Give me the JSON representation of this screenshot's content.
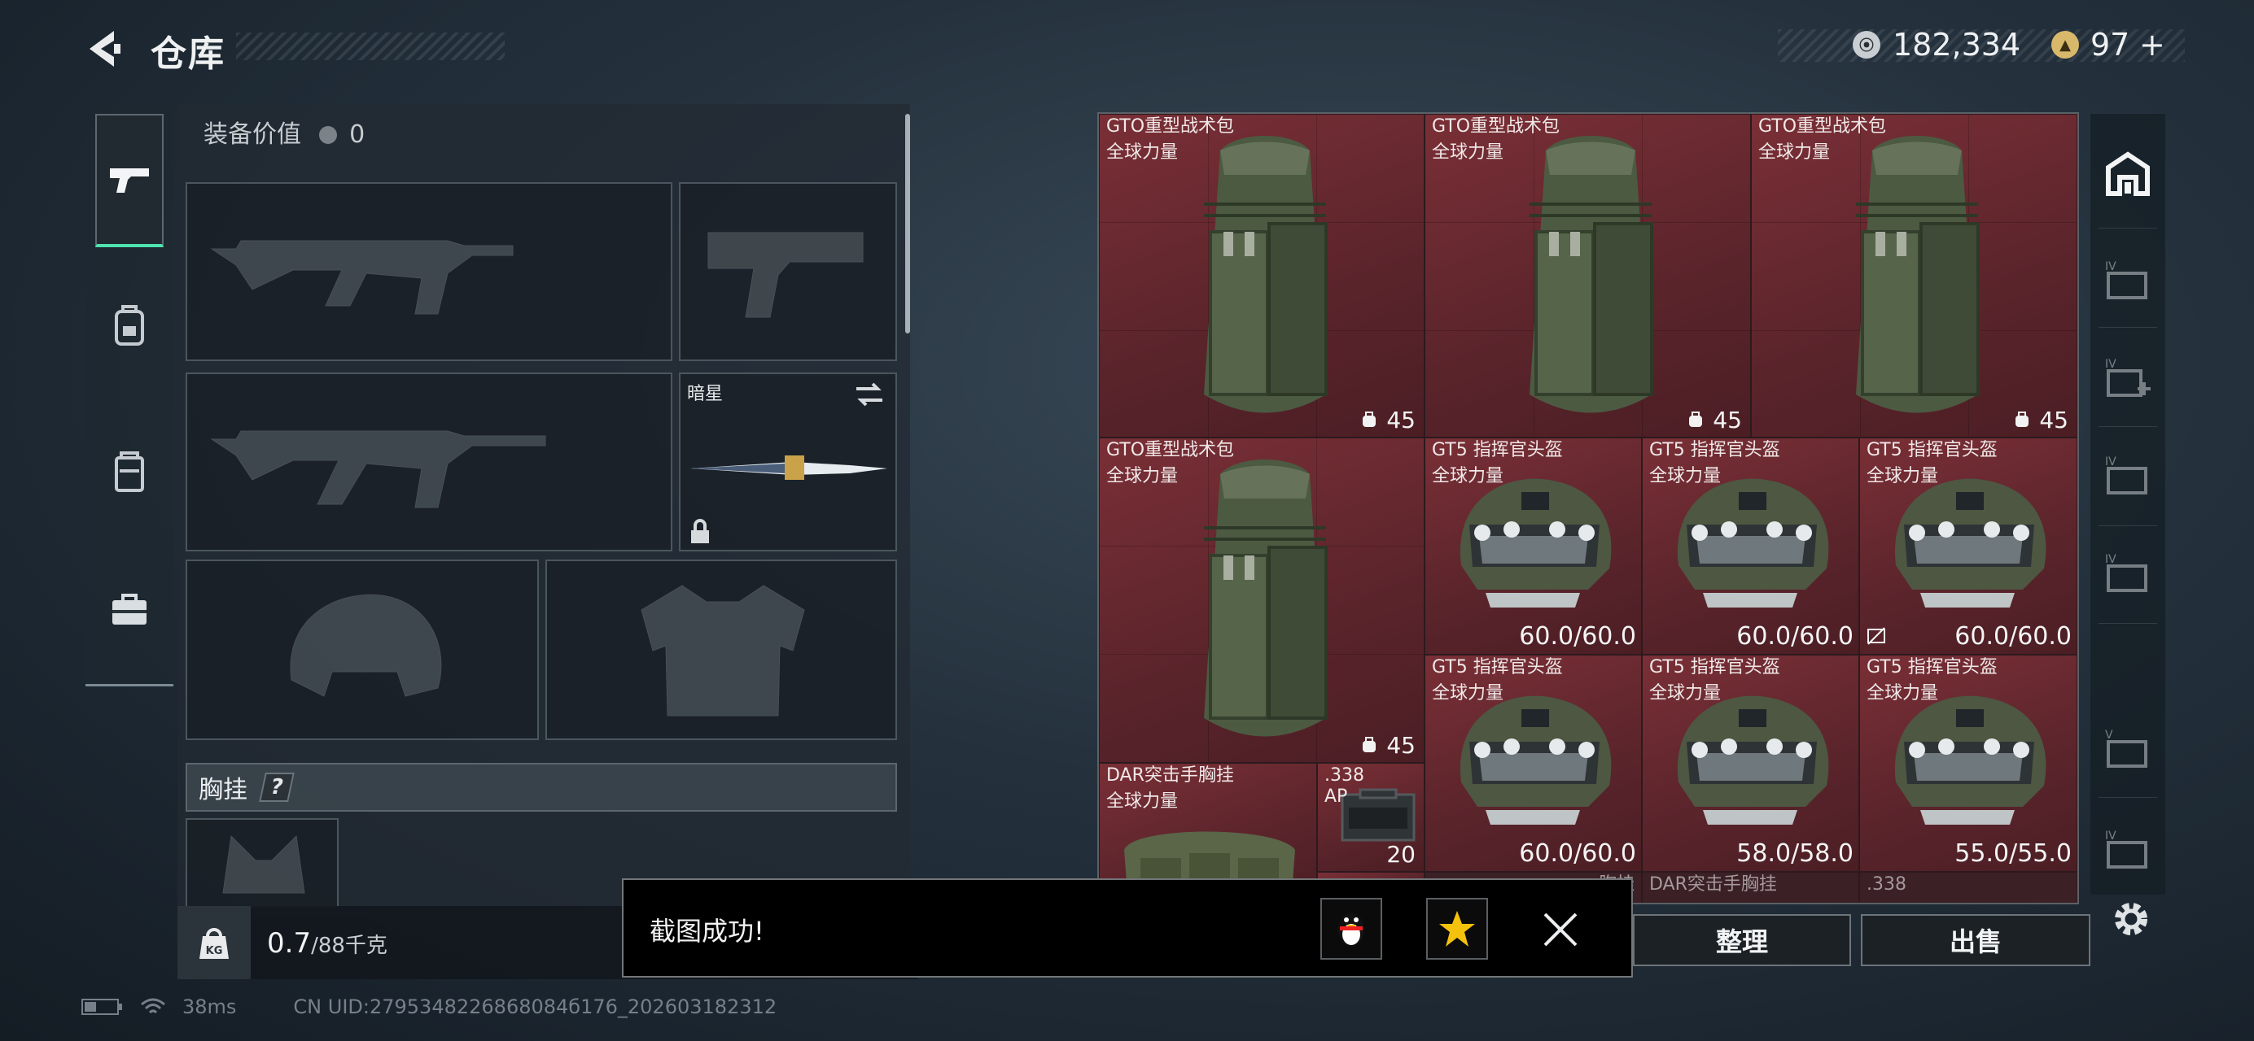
{
  "header": {
    "title": "仓库",
    "currency": {
      "coins": "182,334",
      "tickets": "97",
      "tickets_plus": "+",
      "colors": {
        "coin": "#c9ced2",
        "ticket": "#d8b86a"
      }
    }
  },
  "tabs": [
    {
      "icon": "pistol-icon",
      "active": true
    },
    {
      "icon": "backpack-icon",
      "active": false
    },
    {
      "icon": "vest-icon",
      "active": false
    },
    {
      "icon": "medkit-icon",
      "active": false
    }
  ],
  "equipment": {
    "value_label": "装备价值",
    "value": "0",
    "melee_name": "暗星",
    "vest_label": "胸挂",
    "vest_help": "?"
  },
  "weight": {
    "kg_label": "KG",
    "current": "0.7",
    "max": "/88千克"
  },
  "inventory": {
    "accent": "#6b2a31",
    "cells": [
      {
        "name": "GTO重型战术包",
        "sub": "全球力量",
        "qty": "45"
      },
      {
        "name": "GTO重型战术包",
        "sub": "全球力量",
        "qty": "45"
      },
      {
        "name": "GTO重型战术包",
        "sub": "全球力量",
        "qty": "45"
      },
      {
        "name": "GTO重型战术包",
        "sub": "全球力量",
        "qty": "45"
      },
      {
        "name": "GT5 指挥官头盔",
        "sub": "全球力量",
        "dur": "60.0/60.0"
      },
      {
        "name": "GT5 指挥官头盔",
        "sub": "全球力量",
        "dur": "60.0/60.0"
      },
      {
        "name": "GT5 指挥官头盔",
        "sub": "全球力量",
        "dur": "60.0/60.0"
      },
      {
        "name": "GT5 指挥官头盔",
        "sub": "全球力量",
        "dur": "60.0/60.0"
      },
      {
        "name": "GT5 指挥官头盔",
        "sub": "全球力量",
        "dur": "58.0/58.0"
      },
      {
        "name": "GT5 指挥官头盔",
        "sub": "全球力量",
        "dur": "55.0/55.0"
      },
      {
        "name": "DAR突击手胸挂",
        "sub": "全球力量"
      },
      {
        "name": ".338",
        "sub": "AP",
        "qty": "20"
      },
      {
        "name": "DAR突击手胸挂"
      },
      {
        "name": ".338"
      },
      {
        "name": "胸挂"
      }
    ]
  },
  "buttons": {
    "sort": "整理",
    "sell": "出售"
  },
  "toast": {
    "message": "截图成功!",
    "close_icon": "close-icon"
  },
  "status": {
    "ping": "38ms",
    "uid": "CN UID:2795348226868084б176_202603182312"
  }
}
